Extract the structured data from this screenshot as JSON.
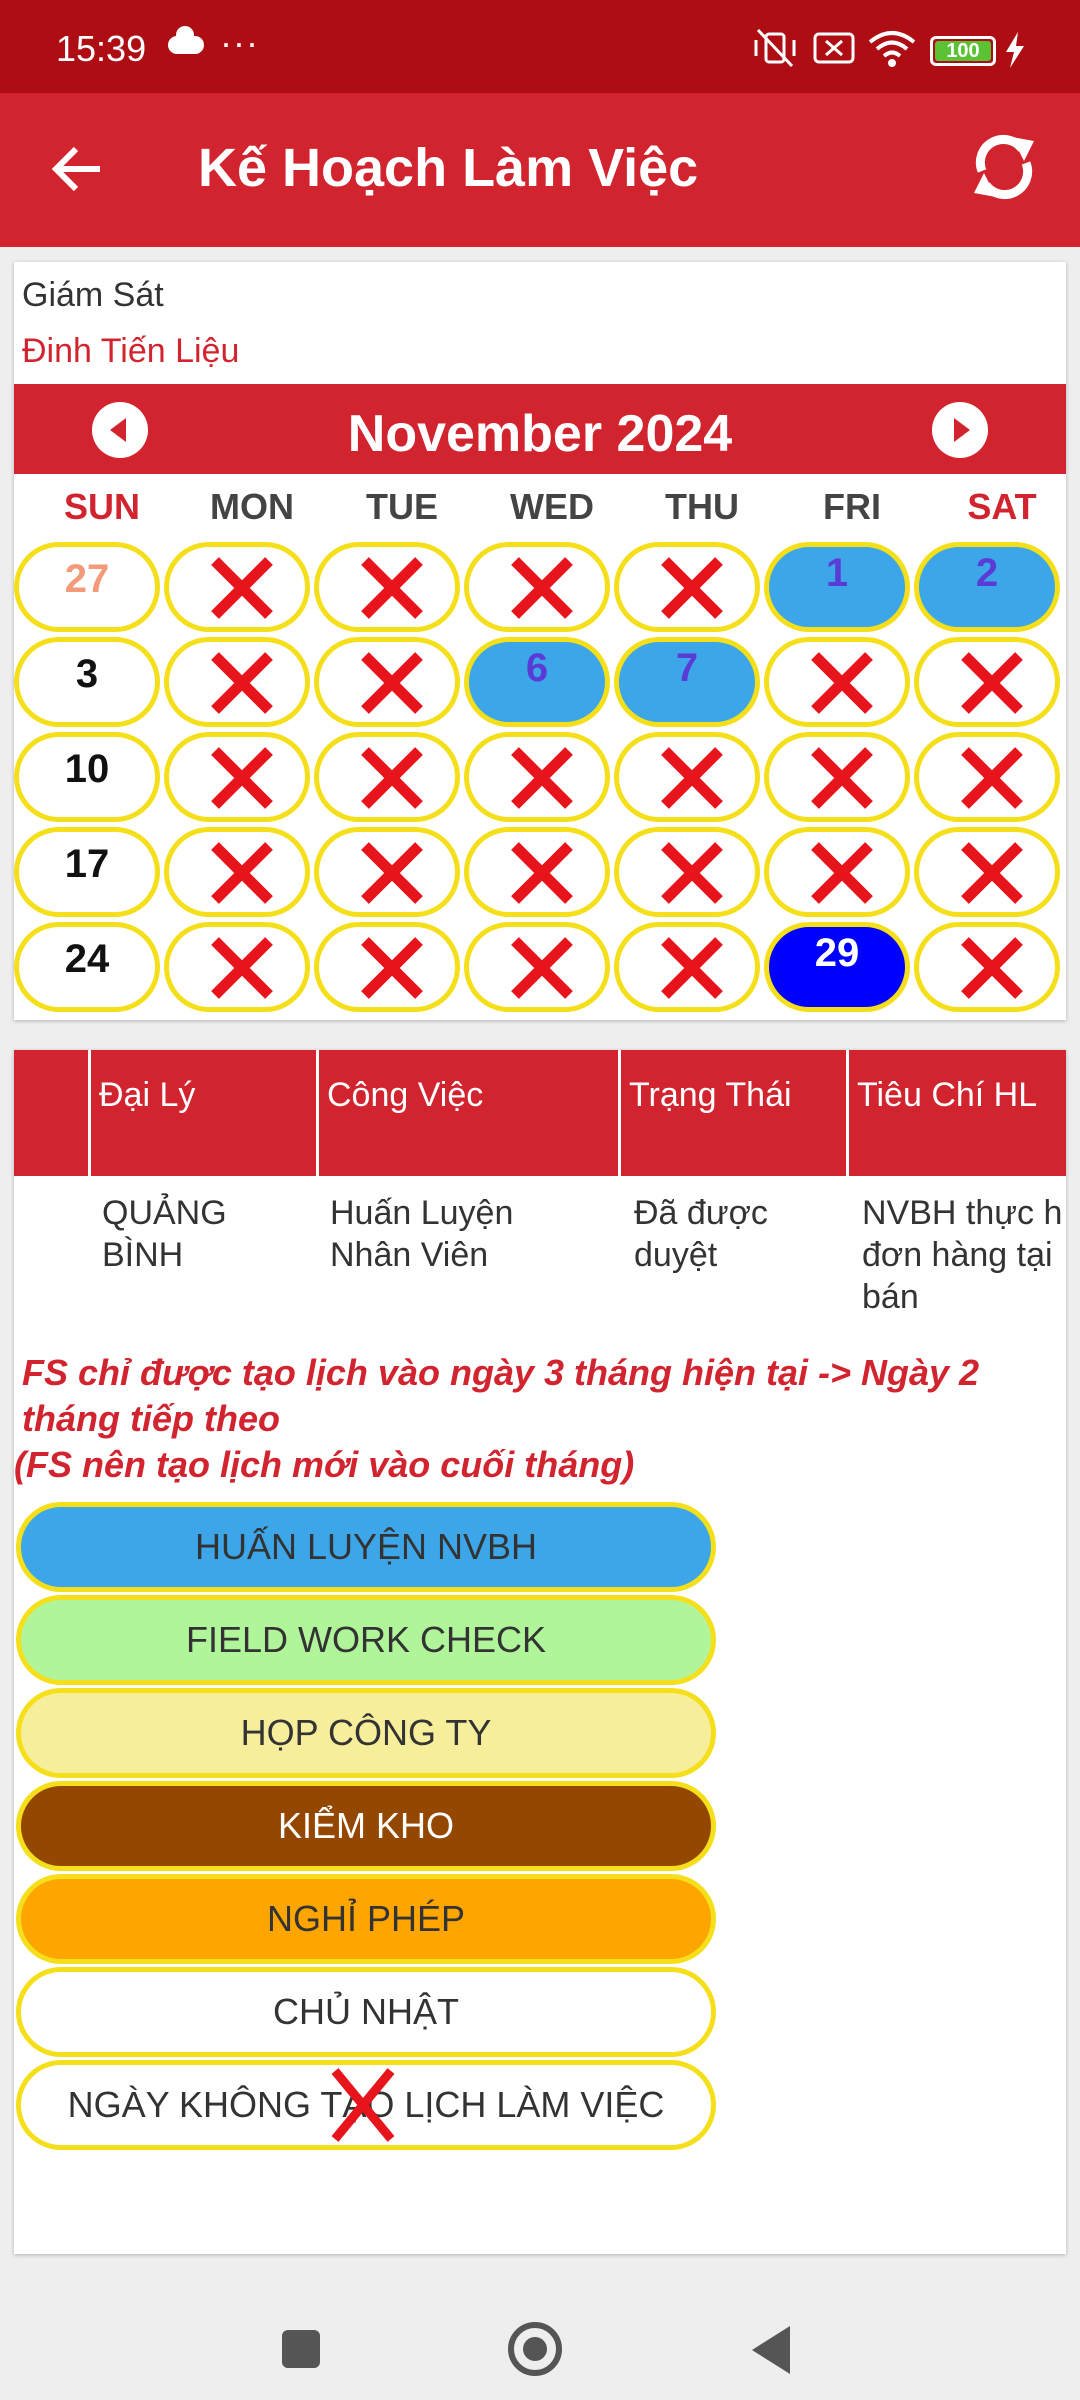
{
  "status_bar": {
    "time": "15:39",
    "dots": "···",
    "battery": "100"
  },
  "app_bar": {
    "title": "Kế Hoạch Làm Việc"
  },
  "supervisor": {
    "label": "Giám Sát",
    "name": "Đinh Tiến Liệu"
  },
  "calendar": {
    "month_label": "November 2024",
    "weekdays": [
      "SUN",
      "MON",
      "TUE",
      "WED",
      "THU",
      "FRI",
      "SAT"
    ],
    "weeks": [
      [
        {
          "d": "27",
          "s": "prev"
        },
        {
          "d": "",
          "s": "x"
        },
        {
          "d": "",
          "s": "x"
        },
        {
          "d": "",
          "s": "x"
        },
        {
          "d": "",
          "s": "x"
        },
        {
          "d": "1",
          "s": "blue"
        },
        {
          "d": "2",
          "s": "blue"
        }
      ],
      [
        {
          "d": "3",
          "s": "sun"
        },
        {
          "d": "",
          "s": "x"
        },
        {
          "d": "",
          "s": "x"
        },
        {
          "d": "6",
          "s": "blue"
        },
        {
          "d": "7",
          "s": "blue"
        },
        {
          "d": "",
          "s": "x"
        },
        {
          "d": "",
          "s": "x"
        }
      ],
      [
        {
          "d": "10",
          "s": "sun"
        },
        {
          "d": "",
          "s": "x"
        },
        {
          "d": "",
          "s": "x"
        },
        {
          "d": "",
          "s": "x"
        },
        {
          "d": "",
          "s": "x"
        },
        {
          "d": "",
          "s": "x"
        },
        {
          "d": "",
          "s": "x"
        }
      ],
      [
        {
          "d": "17",
          "s": "sun"
        },
        {
          "d": "",
          "s": "x"
        },
        {
          "d": "",
          "s": "x"
        },
        {
          "d": "",
          "s": "x"
        },
        {
          "d": "",
          "s": "x"
        },
        {
          "d": "",
          "s": "x"
        },
        {
          "d": "",
          "s": "x"
        }
      ],
      [
        {
          "d": "24",
          "s": "sun"
        },
        {
          "d": "",
          "s": "x"
        },
        {
          "d": "",
          "s": "x"
        },
        {
          "d": "",
          "s": "x"
        },
        {
          "d": "",
          "s": "x"
        },
        {
          "d": "29",
          "s": "selected"
        },
        {
          "d": "",
          "s": "x"
        }
      ]
    ]
  },
  "table": {
    "headers": [
      "Đại Lý",
      "Công Việc",
      "Trạng Thái",
      "Tiêu Chí HL"
    ],
    "row": [
      "QUẢNG BÌNH",
      "Huấn Luyện Nhân Viên",
      "Đã được duyệt",
      "NVBH thực h đơn hàng tại bán"
    ]
  },
  "note": {
    "line1": "FS chỉ được tạo lịch vào ngày 3 tháng hiện tại -> Ngày 2 tháng tiếp theo",
    "line2": "(FS nên tạo lịch mới vào cuối tháng)"
  },
  "legend": [
    {
      "label": "HUẤN LUYỆN NVBH",
      "color": "#3ca6e8"
    },
    {
      "label": "FIELD WORK CHECK",
      "color": "#b0f59a"
    },
    {
      "label": "HỌP CÔNG TY",
      "color": "#f7ee9c"
    },
    {
      "label": "KIỂM KHO",
      "color": "#944700",
      "text_color": "#ffffff"
    },
    {
      "label": "NGHỈ PHÉP",
      "color": "#ffa500"
    },
    {
      "label": "CHỦ NHẬT",
      "color": "#ffffff"
    },
    {
      "label": "NGÀY KHÔNG TẠO LỊCH LÀM VIỆC",
      "color": "#ffffff",
      "icon": "x-icon"
    }
  ],
  "colors": {
    "primary": "#d2242f",
    "status_bar": "#ae0d14",
    "cell_border": "#f4df1a",
    "x_mark": "#e8141c"
  }
}
